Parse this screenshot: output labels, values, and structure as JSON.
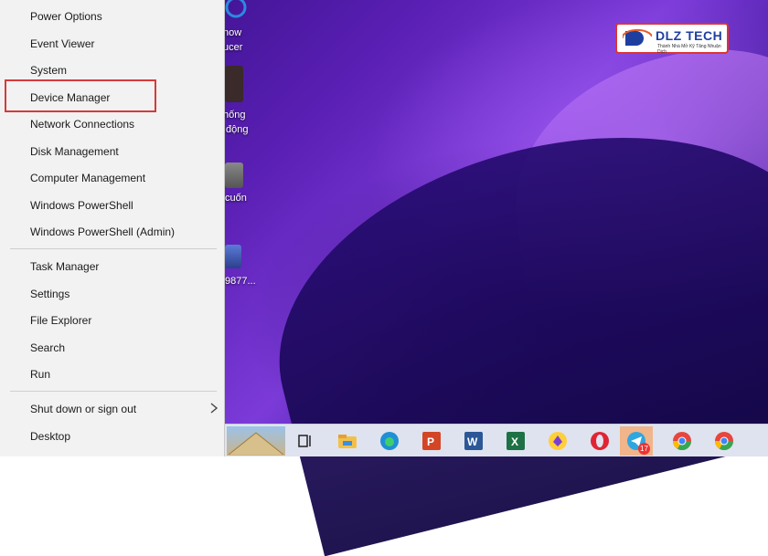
{
  "menu": {
    "items": [
      {
        "label": "Power Options"
      },
      {
        "label": "Event Viewer"
      },
      {
        "label": "System"
      },
      {
        "label": "Device Manager"
      },
      {
        "label": "Network Connections"
      },
      {
        "label": "Disk Management"
      },
      {
        "label": "Computer Management"
      },
      {
        "label": "Windows PowerShell"
      },
      {
        "label": "Windows PowerShell (Admin)"
      },
      {
        "label": "Task Manager"
      },
      {
        "label": "Settings"
      },
      {
        "label": "File Explorer"
      },
      {
        "label": "Search"
      },
      {
        "label": "Run"
      },
      {
        "label": "Shut down or sign out"
      },
      {
        "label": "Desktop"
      }
    ],
    "highlighted_item": "Device Manager",
    "highlight_color": "#d63a3a"
  },
  "desktop_icons": [
    {
      "label": "now\nucer"
    },
    {
      "label": "hống\n động"
    },
    {
      "label": "cuốn"
    },
    {
      "label": "9877..."
    }
  ],
  "logo": {
    "text": "DLZ TECH",
    "tagline": "Thành Nhà Mở Kỹ Tăng Nhuận Dịch"
  },
  "taskbar": {
    "icons": [
      "start-thumbnail",
      "task-view-icon",
      "file-explorer-icon",
      "edge-icon",
      "powerpoint-icon",
      "word-icon",
      "excel-icon",
      "brave-icon",
      "opera-icon",
      "telegram-icon",
      "chrome-icon",
      "chrome-icon"
    ],
    "telegram_badge": "17",
    "active": "telegram-icon",
    "active_color": "#f0b58a"
  }
}
